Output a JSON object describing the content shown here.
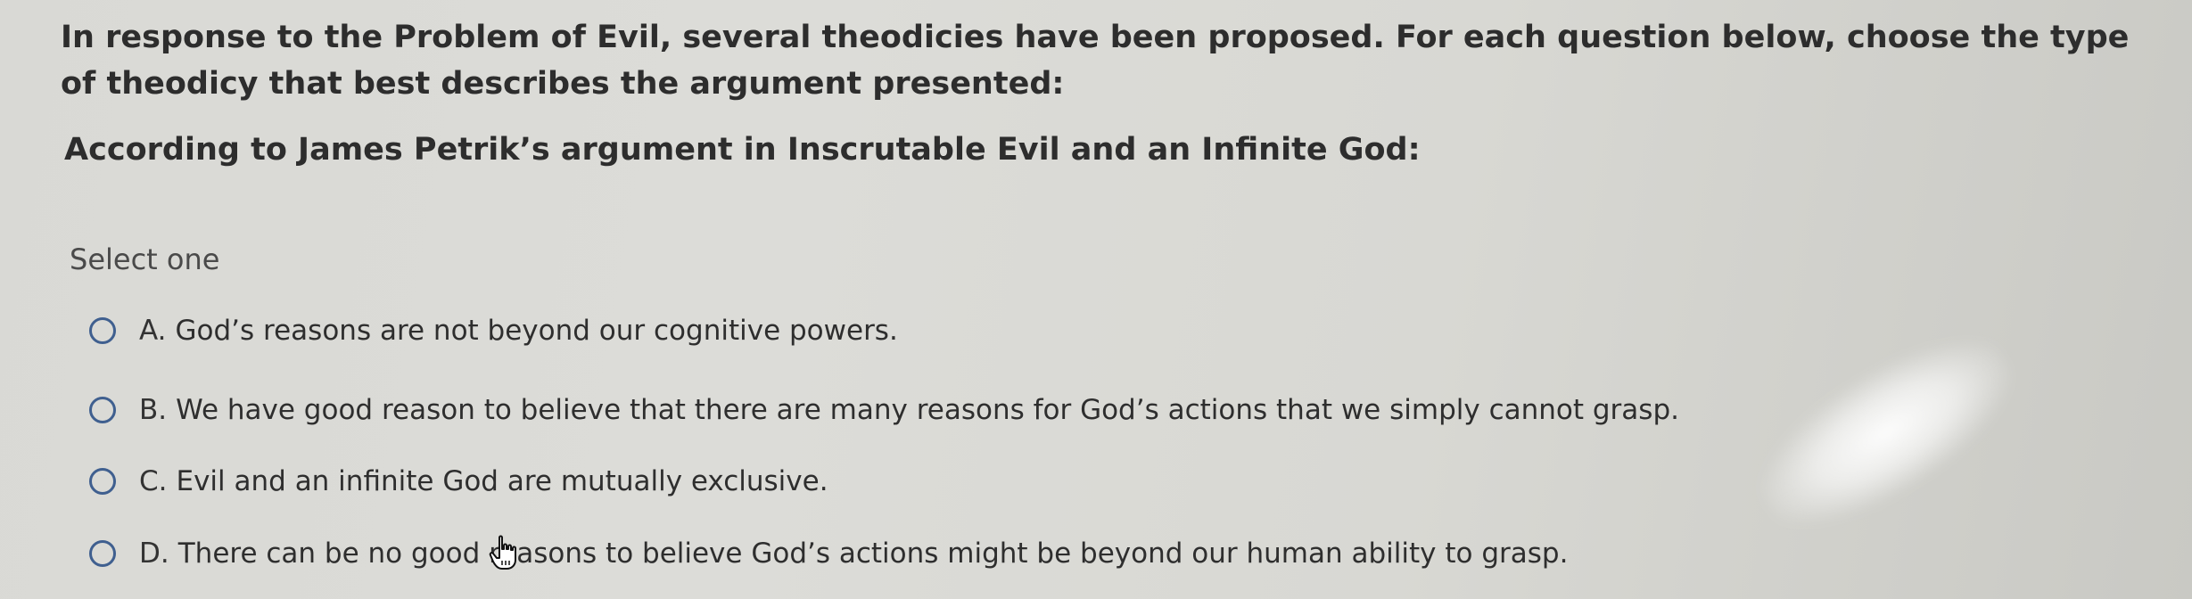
{
  "question": {
    "text": "In response to the Problem of Evil, several theodicies have been proposed. For each question below, choose the type of theodicy that best describes the argument presented:",
    "sub_text": "According to James Petrik’s argument in Inscrutable Evil and an Infinite God:"
  },
  "instructions": "Select one",
  "options": [
    {
      "letter": "A.",
      "text": "God’s reasons are not beyond our cognitive powers."
    },
    {
      "letter": "B.",
      "text": "We have good reason to believe that there are many reasons for God’s actions that we simply cannot grasp."
    },
    {
      "letter": "C.",
      "text": "Evil and an infinite God are mutually exclusive."
    },
    {
      "letter": "D.",
      "text": "There can be no good reasons to believe God’s actions might be beyond our human ability to grasp."
    }
  ],
  "selected_option": null,
  "colors": {
    "radio_border": "#3f5f8f",
    "text": "#2d2d2d",
    "background": "#d9d9d5"
  },
  "icons": {
    "cursor": "hand-pointer-icon",
    "radio": "radio-unchecked-icon"
  }
}
